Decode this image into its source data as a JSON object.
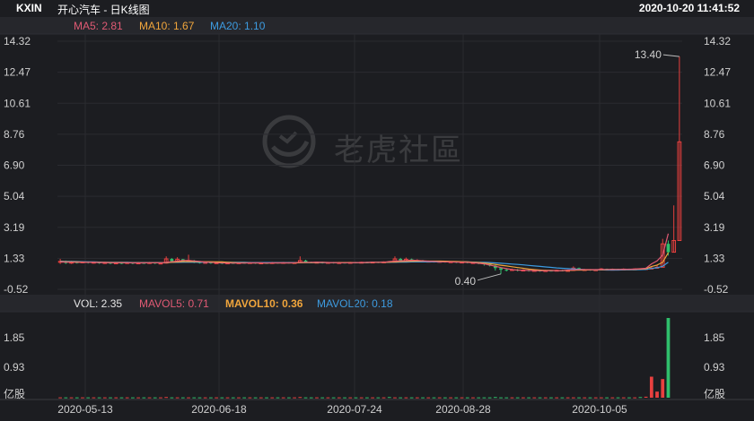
{
  "header": {
    "ticker": "KXIN",
    "subtitle": "开心汽车 - 日K线图",
    "datetime": "2020-10-20 11:41:52"
  },
  "ma_legend": {
    "ma5": "MA5: 2.81",
    "ma10": "MA10: 1.67",
    "ma20": "MA20: 1.10"
  },
  "vol_legend": {
    "vol": "VOL: 2.35",
    "mavol5": "MAVOL5: 0.71",
    "mavol10": "MAVOL10: 0.36",
    "mavol20": "MAVOL20: 0.18"
  },
  "watermark": {
    "text": "老虎社區"
  },
  "colors": {
    "up": "#e8403f",
    "down": "#2fbf6b",
    "ma5": "#e05a74",
    "ma10": "#f0a53c",
    "ma20": "#3d9be0",
    "axis_text": "#cfcfcf",
    "grid": "#2a2b30"
  },
  "chart_data": [
    {
      "type": "candlestick",
      "title": "",
      "y_ticks": [
        "14.32",
        "12.47",
        "10.61",
        "8.76",
        "6.90",
        "5.04",
        "3.19",
        "1.33",
        "-0.52"
      ],
      "ylim": [
        -0.52,
        14.32
      ],
      "x_ticks": [
        "2020-05-13",
        "2020-06-18",
        "2020-07-24",
        "2020-08-28",
        "2020-10-05"
      ],
      "annotations": [
        {
          "label": "13.40",
          "value": 13.4
        },
        {
          "label": "0.40",
          "value": 0.4
        }
      ],
      "candles": [
        {
          "o": 1.1,
          "c": 1.15,
          "h": 1.3,
          "l": 1.0
        },
        {
          "o": 1.15,
          "c": 1.05,
          "h": 1.2,
          "l": 1.0
        },
        {
          "o": 1.05,
          "c": 1.1,
          "h": 1.18,
          "l": 1.0
        },
        {
          "o": 1.1,
          "c": 1.08,
          "h": 1.15,
          "l": 1.02
        },
        {
          "o": 1.08,
          "c": 1.12,
          "h": 1.16,
          "l": 1.04
        },
        {
          "o": 1.12,
          "c": 1.06,
          "h": 1.15,
          "l": 1.02
        },
        {
          "o": 1.06,
          "c": 1.1,
          "h": 1.14,
          "l": 1.02
        },
        {
          "o": 1.1,
          "c": 1.04,
          "h": 1.13,
          "l": 1.0
        },
        {
          "o": 1.04,
          "c": 1.08,
          "h": 1.12,
          "l": 1.0
        },
        {
          "o": 1.08,
          "c": 1.02,
          "h": 1.1,
          "l": 0.98
        },
        {
          "o": 1.02,
          "c": 1.06,
          "h": 1.1,
          "l": 0.98
        },
        {
          "o": 1.06,
          "c": 1.03,
          "h": 1.09,
          "l": 0.99
        },
        {
          "o": 1.03,
          "c": 1.08,
          "h": 1.12,
          "l": 1.0
        },
        {
          "o": 1.08,
          "c": 1.02,
          "h": 1.1,
          "l": 0.98
        },
        {
          "o": 1.02,
          "c": 1.06,
          "h": 1.12,
          "l": 0.98
        },
        {
          "o": 1.06,
          "c": 1.04,
          "h": 1.1,
          "l": 1.0
        },
        {
          "o": 1.04,
          "c": 1.08,
          "h": 1.12,
          "l": 1.0
        },
        {
          "o": 1.08,
          "c": 1.03,
          "h": 1.1,
          "l": 0.99
        },
        {
          "o": 1.03,
          "c": 1.05,
          "h": 1.08,
          "l": 0.98
        },
        {
          "o": 1.05,
          "c": 1.3,
          "h": 1.45,
          "l": 1.02
        },
        {
          "o": 1.3,
          "c": 1.15,
          "h": 1.35,
          "l": 1.1
        },
        {
          "o": 1.15,
          "c": 1.28,
          "h": 1.4,
          "l": 1.12
        },
        {
          "o": 1.28,
          "c": 1.12,
          "h": 1.3,
          "l": 1.08
        },
        {
          "o": 1.12,
          "c": 1.2,
          "h": 1.55,
          "l": 1.1
        },
        {
          "o": 1.2,
          "c": 1.1,
          "h": 1.24,
          "l": 1.05
        },
        {
          "o": 1.1,
          "c": 1.06,
          "h": 1.14,
          "l": 1.02
        },
        {
          "o": 1.06,
          "c": 1.09,
          "h": 1.12,
          "l": 1.02
        },
        {
          "o": 1.09,
          "c": 1.04,
          "h": 1.12,
          "l": 1.0
        },
        {
          "o": 1.04,
          "c": 1.07,
          "h": 1.1,
          "l": 1.0
        },
        {
          "o": 1.07,
          "c": 1.03,
          "h": 1.09,
          "l": 0.99
        },
        {
          "o": 1.03,
          "c": 1.06,
          "h": 1.09,
          "l": 1.0
        },
        {
          "o": 1.06,
          "c": 1.04,
          "h": 1.08,
          "l": 1.0
        },
        {
          "o": 1.04,
          "c": 1.07,
          "h": 1.1,
          "l": 1.0
        },
        {
          "o": 1.07,
          "c": 1.05,
          "h": 1.09,
          "l": 1.01
        },
        {
          "o": 1.05,
          "c": 1.08,
          "h": 1.12,
          "l": 1.02
        },
        {
          "o": 1.08,
          "c": 1.04,
          "h": 1.1,
          "l": 1.0
        },
        {
          "o": 1.04,
          "c": 1.06,
          "h": 1.09,
          "l": 1.0
        },
        {
          "o": 1.06,
          "c": 1.03,
          "h": 1.08,
          "l": 1.0
        },
        {
          "o": 1.03,
          "c": 1.08,
          "h": 1.12,
          "l": 1.0
        },
        {
          "o": 1.08,
          "c": 1.05,
          "h": 1.1,
          "l": 1.02
        },
        {
          "o": 1.05,
          "c": 1.09,
          "h": 1.12,
          "l": 1.02
        },
        {
          "o": 1.09,
          "c": 1.06,
          "h": 1.12,
          "l": 1.02
        },
        {
          "o": 1.06,
          "c": 1.08,
          "h": 1.11,
          "l": 1.02
        },
        {
          "o": 1.08,
          "c": 1.2,
          "h": 1.45,
          "l": 1.05
        },
        {
          "o": 1.2,
          "c": 1.1,
          "h": 1.25,
          "l": 1.06
        },
        {
          "o": 1.1,
          "c": 1.07,
          "h": 1.14,
          "l": 1.04
        },
        {
          "o": 1.07,
          "c": 1.1,
          "h": 1.13,
          "l": 1.04
        },
        {
          "o": 1.1,
          "c": 1.06,
          "h": 1.13,
          "l": 1.02
        },
        {
          "o": 1.06,
          "c": 1.09,
          "h": 1.12,
          "l": 1.02
        },
        {
          "o": 1.09,
          "c": 1.05,
          "h": 1.12,
          "l": 1.02
        },
        {
          "o": 1.05,
          "c": 1.08,
          "h": 1.12,
          "l": 1.02
        },
        {
          "o": 1.08,
          "c": 1.06,
          "h": 1.11,
          "l": 1.02
        },
        {
          "o": 1.06,
          "c": 1.09,
          "h": 1.12,
          "l": 1.02
        },
        {
          "o": 1.09,
          "c": 1.07,
          "h": 1.12,
          "l": 1.03
        },
        {
          "o": 1.07,
          "c": 1.1,
          "h": 1.13,
          "l": 1.04
        },
        {
          "o": 1.1,
          "c": 1.08,
          "h": 1.13,
          "l": 1.04
        },
        {
          "o": 1.08,
          "c": 1.11,
          "h": 1.14,
          "l": 1.05
        },
        {
          "o": 1.11,
          "c": 1.09,
          "h": 1.14,
          "l": 1.05
        },
        {
          "o": 1.09,
          "c": 1.12,
          "h": 1.15,
          "l": 1.05
        },
        {
          "o": 1.12,
          "c": 1.1,
          "h": 1.15,
          "l": 1.06
        },
        {
          "o": 1.1,
          "c": 1.3,
          "h": 1.45,
          "l": 1.08
        },
        {
          "o": 1.3,
          "c": 1.18,
          "h": 1.36,
          "l": 1.12
        },
        {
          "o": 1.18,
          "c": 1.28,
          "h": 1.38,
          "l": 1.14
        },
        {
          "o": 1.28,
          "c": 1.15,
          "h": 1.32,
          "l": 1.1
        },
        {
          "o": 1.15,
          "c": 1.2,
          "h": 1.28,
          "l": 1.1
        },
        {
          "o": 1.2,
          "c": 1.14,
          "h": 1.24,
          "l": 1.1
        },
        {
          "o": 1.14,
          "c": 1.16,
          "h": 1.2,
          "l": 1.1
        },
        {
          "o": 1.16,
          "c": 1.12,
          "h": 1.19,
          "l": 1.08
        },
        {
          "o": 1.12,
          "c": 1.15,
          "h": 1.18,
          "l": 1.08
        },
        {
          "o": 1.15,
          "c": 1.11,
          "h": 1.17,
          "l": 1.07
        },
        {
          "o": 1.11,
          "c": 1.13,
          "h": 1.16,
          "l": 1.07
        },
        {
          "o": 1.13,
          "c": 1.09,
          "h": 1.15,
          "l": 1.05
        },
        {
          "o": 1.09,
          "c": 1.11,
          "h": 1.14,
          "l": 1.05
        },
        {
          "o": 1.11,
          "c": 1.07,
          "h": 1.13,
          "l": 1.03
        },
        {
          "o": 1.07,
          "c": 1.08,
          "h": 1.11,
          "l": 1.02
        },
        {
          "o": 1.08,
          "c": 1.03,
          "h": 1.1,
          "l": 0.98
        },
        {
          "o": 1.03,
          "c": 0.98,
          "h": 1.05,
          "l": 0.9
        },
        {
          "o": 0.98,
          "c": 0.9,
          "h": 1.0,
          "l": 0.85
        },
        {
          "o": 0.9,
          "c": 0.75,
          "h": 0.95,
          "l": 0.6
        },
        {
          "o": 0.75,
          "c": 0.65,
          "h": 0.8,
          "l": 0.4
        },
        {
          "o": 0.65,
          "c": 0.62,
          "h": 0.7,
          "l": 0.55
        },
        {
          "o": 0.62,
          "c": 0.66,
          "h": 0.72,
          "l": 0.58
        },
        {
          "o": 0.66,
          "c": 0.6,
          "h": 0.7,
          "l": 0.55
        },
        {
          "o": 0.6,
          "c": 0.63,
          "h": 0.68,
          "l": 0.56
        },
        {
          "o": 0.63,
          "c": 0.58,
          "h": 0.66,
          "l": 0.54
        },
        {
          "o": 0.58,
          "c": 0.61,
          "h": 0.66,
          "l": 0.55
        },
        {
          "o": 0.61,
          "c": 0.57,
          "h": 0.64,
          "l": 0.53
        },
        {
          "o": 0.57,
          "c": 0.6,
          "h": 0.65,
          "l": 0.54
        },
        {
          "o": 0.6,
          "c": 0.58,
          "h": 0.63,
          "l": 0.54
        },
        {
          "o": 0.58,
          "c": 0.62,
          "h": 0.66,
          "l": 0.55
        },
        {
          "o": 0.62,
          "c": 0.59,
          "h": 0.65,
          "l": 0.55
        },
        {
          "o": 0.59,
          "c": 0.61,
          "h": 0.66,
          "l": 0.56
        },
        {
          "o": 0.61,
          "c": 0.75,
          "h": 0.85,
          "l": 0.58
        },
        {
          "o": 0.75,
          "c": 0.64,
          "h": 0.78,
          "l": 0.6
        },
        {
          "o": 0.64,
          "c": 0.66,
          "h": 0.7,
          "l": 0.6
        },
        {
          "o": 0.66,
          "c": 0.63,
          "h": 0.69,
          "l": 0.59
        },
        {
          "o": 0.63,
          "c": 0.65,
          "h": 0.69,
          "l": 0.6
        },
        {
          "o": 0.65,
          "c": 0.7,
          "h": 0.75,
          "l": 0.62
        },
        {
          "o": 0.7,
          "c": 0.66,
          "h": 0.72,
          "l": 0.62
        },
        {
          "o": 0.66,
          "c": 0.68,
          "h": 0.72,
          "l": 0.63
        },
        {
          "o": 0.68,
          "c": 0.65,
          "h": 0.71,
          "l": 0.62
        },
        {
          "o": 0.65,
          "c": 0.69,
          "h": 0.73,
          "l": 0.63
        },
        {
          "o": 0.69,
          "c": 0.66,
          "h": 0.72,
          "l": 0.63
        },
        {
          "o": 0.66,
          "c": 0.7,
          "h": 0.74,
          "l": 0.64
        },
        {
          "o": 0.7,
          "c": 0.68,
          "h": 0.73,
          "l": 0.64
        },
        {
          "o": 0.68,
          "c": 0.72,
          "h": 0.78,
          "l": 0.66
        },
        {
          "o": 0.72,
          "c": 0.75,
          "h": 0.85,
          "l": 0.68
        },
        {
          "o": 0.75,
          "c": 0.8,
          "h": 0.95,
          "l": 0.72
        },
        {
          "o": 0.8,
          "c": 2.2,
          "h": 2.5,
          "l": 0.8
        },
        {
          "o": 2.2,
          "c": 1.7,
          "h": 2.4,
          "l": 1.5
        },
        {
          "o": 1.7,
          "c": 2.4,
          "h": 4.5,
          "l": 1.7
        },
        {
          "o": 2.4,
          "c": 8.3,
          "h": 13.4,
          "l": 2.4
        }
      ],
      "ma5": [
        1.12,
        1.11,
        1.1,
        1.1,
        1.09,
        1.09,
        1.09,
        1.08,
        1.08,
        1.07,
        1.07,
        1.07,
        1.07,
        1.06,
        1.06,
        1.06,
        1.07,
        1.07,
        1.06,
        1.1,
        1.13,
        1.17,
        1.21,
        1.21,
        1.18,
        1.15,
        1.11,
        1.1,
        1.07,
        1.06,
        1.05,
        1.05,
        1.05,
        1.05,
        1.06,
        1.06,
        1.06,
        1.05,
        1.06,
        1.06,
        1.06,
        1.06,
        1.07,
        1.1,
        1.1,
        1.1,
        1.11,
        1.1,
        1.08,
        1.08,
        1.07,
        1.07,
        1.07,
        1.08,
        1.08,
        1.09,
        1.1,
        1.1,
        1.1,
        1.14,
        1.16,
        1.19,
        1.2,
        1.22,
        1.21,
        1.19,
        1.16,
        1.15,
        1.13,
        1.12,
        1.12,
        1.11,
        1.1,
        1.09,
        1.07,
        1.04,
        1.0,
        0.93,
        0.86,
        0.78,
        0.72,
        0.66,
        0.63,
        0.62,
        0.61,
        0.6,
        0.6,
        0.59,
        0.6,
        0.6,
        0.6,
        0.63,
        0.64,
        0.66,
        0.66,
        0.66,
        0.66,
        0.67,
        0.67,
        0.67,
        0.67,
        0.68,
        0.68,
        0.69,
        0.71,
        0.74,
        1.0,
        1.18,
        1.53,
        2.81
      ],
      "ma10": [
        1.14,
        1.13,
        1.12,
        1.12,
        1.11,
        1.1,
        1.1,
        1.09,
        1.09,
        1.08,
        1.08,
        1.08,
        1.07,
        1.07,
        1.07,
        1.07,
        1.07,
        1.07,
        1.07,
        1.08,
        1.1,
        1.12,
        1.14,
        1.14,
        1.14,
        1.13,
        1.13,
        1.13,
        1.12,
        1.12,
        1.1,
        1.08,
        1.07,
        1.07,
        1.06,
        1.06,
        1.06,
        1.05,
        1.06,
        1.06,
        1.06,
        1.06,
        1.06,
        1.07,
        1.08,
        1.08,
        1.08,
        1.09,
        1.08,
        1.08,
        1.08,
        1.08,
        1.08,
        1.08,
        1.08,
        1.08,
        1.09,
        1.09,
        1.09,
        1.11,
        1.12,
        1.14,
        1.15,
        1.16,
        1.17,
        1.17,
        1.17,
        1.17,
        1.17,
        1.16,
        1.15,
        1.14,
        1.13,
        1.12,
        1.1,
        1.08,
        1.05,
        1.01,
        0.97,
        0.92,
        0.88,
        0.83,
        0.78,
        0.74,
        0.69,
        0.66,
        0.63,
        0.61,
        0.61,
        0.6,
        0.6,
        0.61,
        0.62,
        0.63,
        0.63,
        0.64,
        0.65,
        0.65,
        0.66,
        0.67,
        0.67,
        0.67,
        0.67,
        0.68,
        0.69,
        0.71,
        0.84,
        0.93,
        1.1,
        1.67
      ],
      "ma20": [
        1.16,
        1.15,
        1.15,
        1.14,
        1.13,
        1.12,
        1.12,
        1.11,
        1.1,
        1.1,
        1.09,
        1.09,
        1.09,
        1.08,
        1.08,
        1.08,
        1.08,
        1.08,
        1.08,
        1.08,
        1.09,
        1.09,
        1.1,
        1.1,
        1.1,
        1.1,
        1.1,
        1.1,
        1.1,
        1.1,
        1.09,
        1.09,
        1.09,
        1.09,
        1.08,
        1.08,
        1.08,
        1.08,
        1.08,
        1.08,
        1.08,
        1.08,
        1.08,
        1.08,
        1.08,
        1.08,
        1.08,
        1.08,
        1.08,
        1.08,
        1.08,
        1.08,
        1.08,
        1.08,
        1.08,
        1.08,
        1.09,
        1.09,
        1.09,
        1.1,
        1.1,
        1.11,
        1.11,
        1.12,
        1.12,
        1.12,
        1.12,
        1.12,
        1.12,
        1.12,
        1.12,
        1.12,
        1.12,
        1.12,
        1.11,
        1.1,
        1.09,
        1.08,
        1.06,
        1.04,
        1.02,
        0.99,
        0.97,
        0.94,
        0.91,
        0.88,
        0.85,
        0.82,
        0.79,
        0.76,
        0.74,
        0.72,
        0.7,
        0.68,
        0.66,
        0.65,
        0.64,
        0.64,
        0.63,
        0.63,
        0.63,
        0.64,
        0.64,
        0.65,
        0.66,
        0.67,
        0.73,
        0.77,
        0.86,
        1.1
      ]
    },
    {
      "type": "bar",
      "title": "",
      "y_ticks": [
        "1.85",
        "0.93",
        "亿股"
      ],
      "ylim": [
        0,
        2.35
      ],
      "volume": [
        0.01,
        0.01,
        0.01,
        0.01,
        0.01,
        0.01,
        0.01,
        0.01,
        0.01,
        0.01,
        0.01,
        0.01,
        0.01,
        0.01,
        0.01,
        0.01,
        0.01,
        0.01,
        0.01,
        0.02,
        0.01,
        0.01,
        0.01,
        0.01,
        0.01,
        0.01,
        0.01,
        0.01,
        0.01,
        0.01,
        0.01,
        0.01,
        0.01,
        0.01,
        0.01,
        0.01,
        0.01,
        0.01,
        0.01,
        0.01,
        0.01,
        0.01,
        0.01,
        0.02,
        0.01,
        0.01,
        0.01,
        0.01,
        0.01,
        0.01,
        0.01,
        0.01,
        0.01,
        0.01,
        0.01,
        0.01,
        0.01,
        0.01,
        0.01,
        0.02,
        0.01,
        0.01,
        0.01,
        0.01,
        0.01,
        0.01,
        0.01,
        0.01,
        0.01,
        0.01,
        0.01,
        0.01,
        0.01,
        0.01,
        0.01,
        0.01,
        0.01,
        0.01,
        0.02,
        0.01,
        0.01,
        0.01,
        0.01,
        0.01,
        0.01,
        0.01,
        0.01,
        0.01,
        0.01,
        0.01,
        0.01,
        0.01,
        0.01,
        0.01,
        0.01,
        0.01,
        0.01,
        0.01,
        0.01,
        0.01,
        0.01,
        0.01,
        0.01,
        0.01,
        0.02,
        0.03,
        0.62,
        0.18,
        0.55,
        2.35
      ]
    }
  ]
}
